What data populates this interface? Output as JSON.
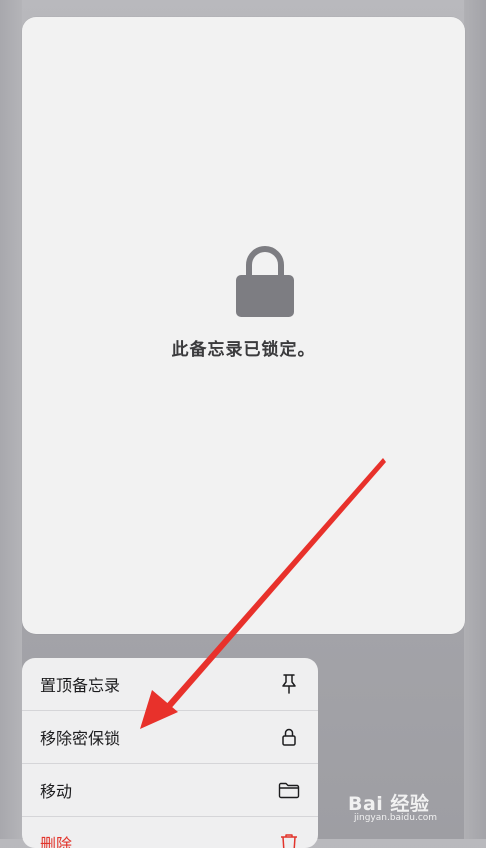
{
  "note_preview": {
    "locked_message": "此备忘录已锁定。"
  },
  "context_menu": {
    "items": [
      {
        "label": "置顶备忘录",
        "icon": "pin-icon"
      },
      {
        "label": "移除密保锁",
        "icon": "lock-icon"
      },
      {
        "label": "移动",
        "icon": "folder-icon"
      },
      {
        "label": "删除",
        "icon": "trash-icon",
        "destructive": true
      }
    ]
  },
  "watermark": {
    "logo_text": "Bai 经验",
    "sub_text": "jingyan.baidu.com"
  },
  "colors": {
    "destructive": "#e2342b",
    "arrow": "#e8312b",
    "lock_icon": "#7d7d82"
  }
}
